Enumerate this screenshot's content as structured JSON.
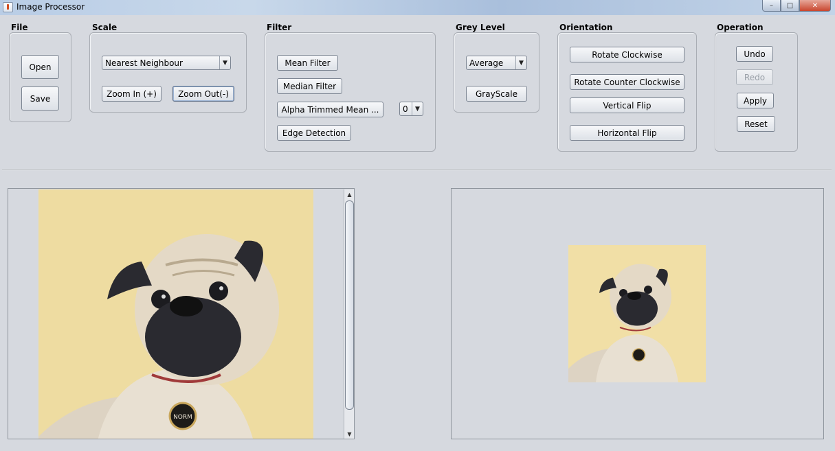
{
  "window": {
    "title": "Image Processor",
    "minimize": "–",
    "maximize": "□",
    "close": "✕"
  },
  "file": {
    "label": "File",
    "open": "Open",
    "save": "Save"
  },
  "scale": {
    "label": "Scale",
    "method": "Nearest Neighbour",
    "zoom_in": "Zoom In (+)",
    "zoom_out": "Zoom Out(-)"
  },
  "filter": {
    "label": "Filter",
    "mean": "Mean Filter",
    "median": "Median Filter",
    "alpha_trimmed": "Alpha Trimmed Mean ...",
    "alpha_value": "0",
    "edge": "Edge Detection"
  },
  "grey_level": {
    "label": "Grey Level",
    "method": "Average",
    "grayscale": "GrayScale"
  },
  "orientation": {
    "label": "Orientation",
    "rotate_cw": "Rotate Clockwise",
    "rotate_ccw": "Rotate Counter Clockwise",
    "vertical_flip": "Vertical Flip",
    "horizontal_flip": "Horizontal Flip"
  },
  "operation": {
    "label": "Operation",
    "undo": "Undo",
    "redo": "Redo",
    "apply": "Apply",
    "reset": "Reset"
  },
  "images": {
    "tag_text": "NORM"
  },
  "colors": {
    "background": "#d6d9df",
    "wall": "#f1dfa6",
    "fur": "#e8e0d2",
    "mask": "#2a2a30"
  }
}
